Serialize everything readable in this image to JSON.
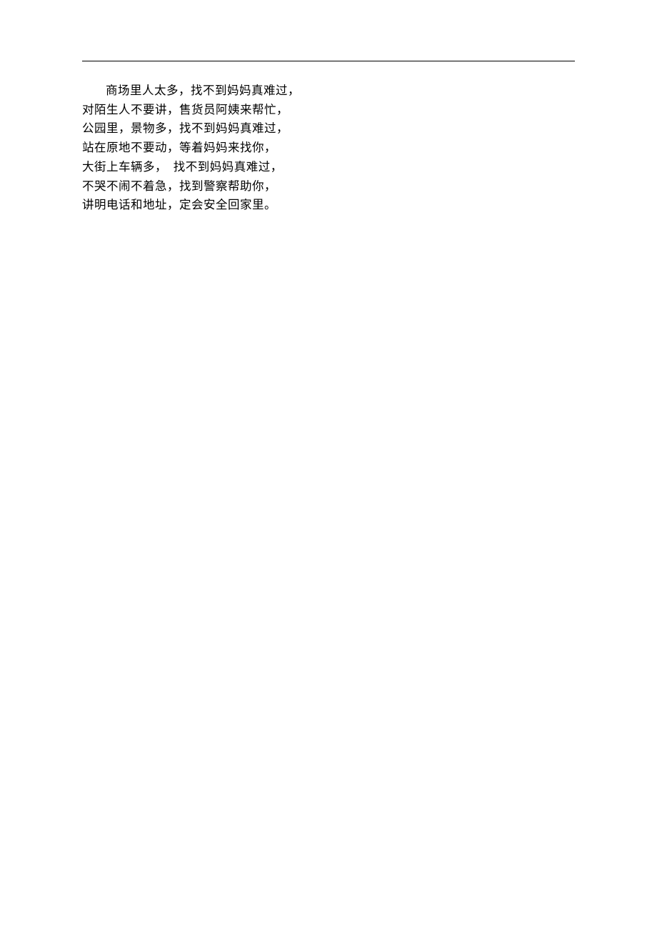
{
  "content": {
    "lines": [
      "商场里人太多，找不到妈妈真难过，",
      "对陌生人不要讲，售货员阿姨来帮忙，",
      "公园里，景物多，找不到妈妈真难过，",
      "站在原地不要动，等着妈妈来找你，",
      "大街上车辆多，　找不到妈妈真难过，",
      "不哭不闹不着急，找到警察帮助你，",
      "讲明电话和地址，定会安全回家里。"
    ]
  }
}
